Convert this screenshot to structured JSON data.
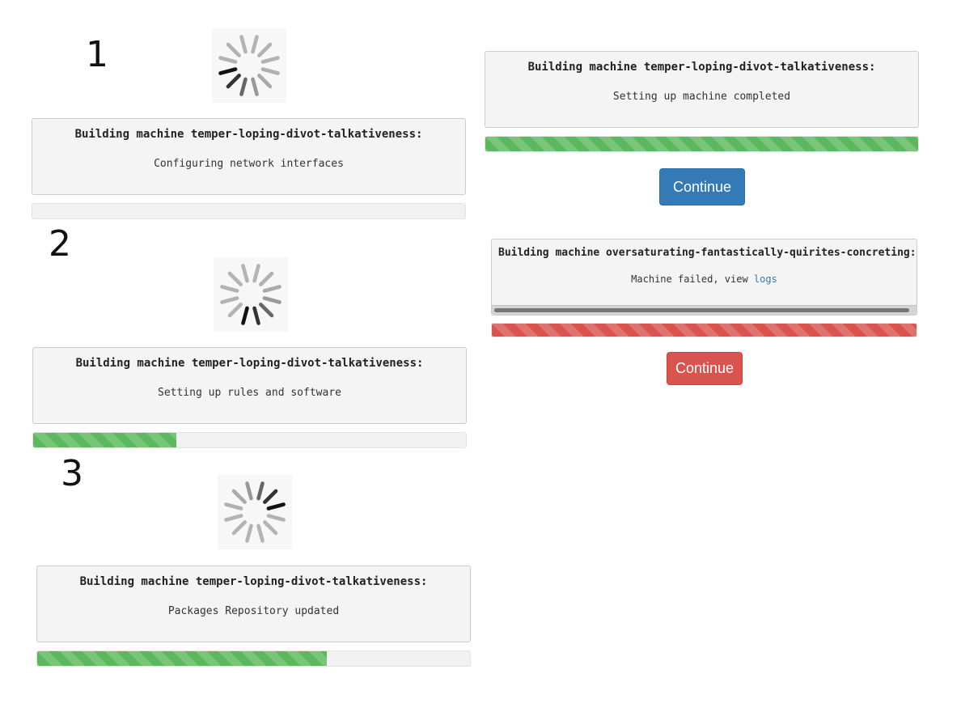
{
  "steps": [
    {
      "number": "1",
      "title": "Building machine temper-loping-divot-talkativeness:",
      "status": "Configuring network interfaces",
      "progress": 0
    },
    {
      "number": "2",
      "title": "Building machine temper-loping-divot-talkativeness:",
      "status": "Setting up rules and software",
      "progress": 0.33
    },
    {
      "number": "3",
      "title": "Building machine temper-loping-divot-talkativeness:",
      "status": "Packages Repository updated",
      "progress": 0.67
    }
  ],
  "completed": {
    "title": "Building machine temper-loping-divot-talkativeness:",
    "status": "Setting up machine completed",
    "progress": 1,
    "button_label": "Continue"
  },
  "failed": {
    "title": "Building machine oversaturating-fantastically-quirites-concreting:",
    "status_prefix": "Machine failed, view",
    "logs_link": "logs",
    "progress": 1,
    "button_label": "Continue"
  },
  "colors": {
    "success": "#5cb85c",
    "danger": "#d9534f",
    "primary": "#337ab7",
    "link": "#337ab7"
  },
  "icons": {
    "spinner": "loading-spinner-icon"
  }
}
